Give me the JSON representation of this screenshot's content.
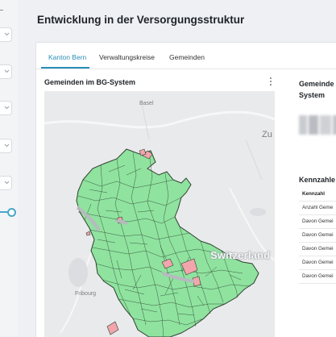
{
  "page_title": "Entwicklung in der Versorgungsstruktur",
  "tabs": [
    {
      "label": "Kanton Bern",
      "active": true
    },
    {
      "label": "Verwaltungskreise",
      "active": false
    },
    {
      "label": "Gemeinden",
      "active": false
    }
  ],
  "map_card": {
    "title": "Gemeinden im BG-System",
    "labels": {
      "basel": "Basel",
      "zu": "Zu",
      "fribourg": "Fribourg",
      "country": "Switzerland"
    }
  },
  "right_card": {
    "title": "Gemeinde System"
  },
  "kennzahlen": {
    "title": "Kennzahle",
    "header": "Kennzahl",
    "rows": [
      "Anzahl Geme",
      "Davon Gemei",
      "Davon Gemei",
      "Davon Gemei",
      "Davon Gemei",
      "Davon Gemei"
    ]
  },
  "colors": {
    "accent": "#2a8fb8",
    "municipality_in_system": "#8fe39f",
    "municipality_highlight": "#f2a5ac",
    "border": "#2f4030"
  }
}
